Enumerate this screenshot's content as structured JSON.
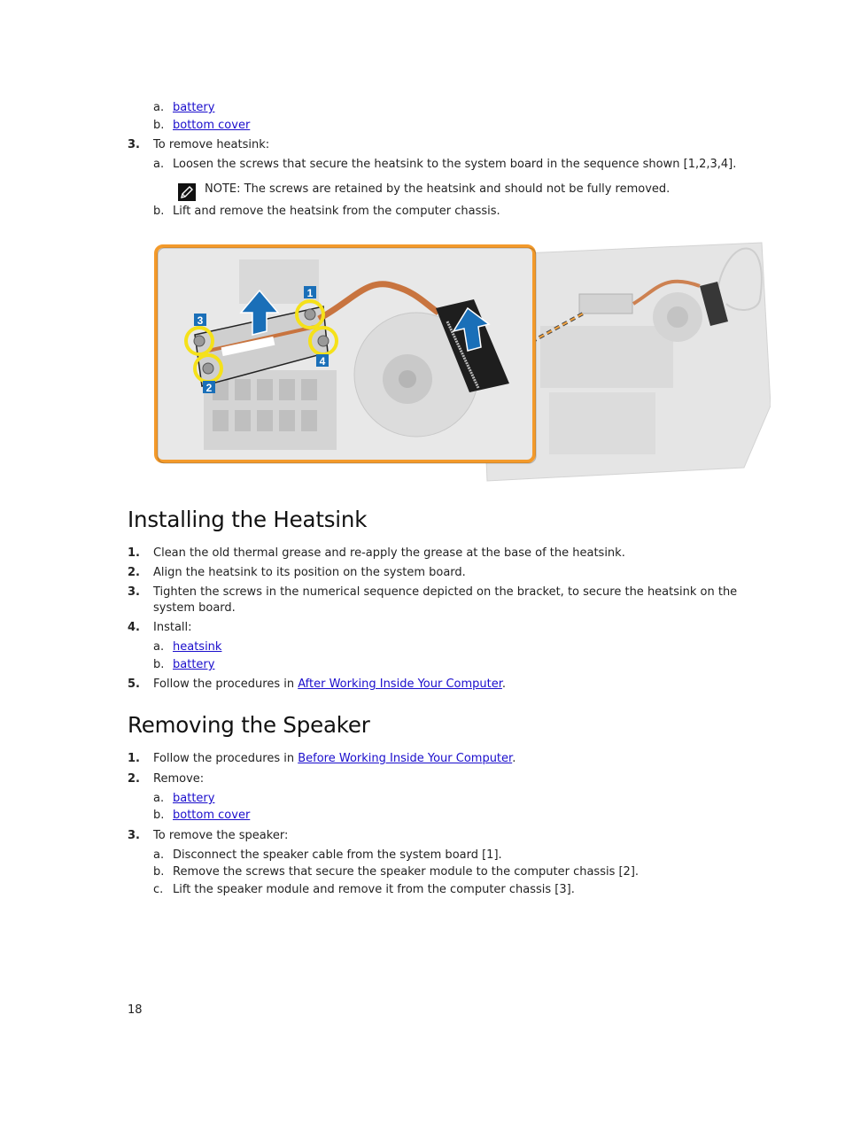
{
  "top_section": {
    "items": [
      {
        "marker": "a.",
        "link": "battery"
      },
      {
        "marker": "b.",
        "link": "bottom cover"
      }
    ],
    "step3": {
      "number": "3.",
      "text": "To remove heatsink:",
      "sub_a": {
        "marker": "a.",
        "text": "Loosen the screws that secure the heatsink to the system board in the sequence shown [1,2,3,4]."
      },
      "note": {
        "label": "NOTE:",
        "text": " The screws are retained by the heatsink and should not be fully removed."
      },
      "sub_b": {
        "marker": "b.",
        "text": "Lift and remove the heatsink from the computer chassis."
      }
    }
  },
  "figure": {
    "callouts": [
      "1",
      "2",
      "3",
      "4"
    ],
    "colors": {
      "frame": "#f39a2b",
      "callout_bg": "#1a6fb8",
      "ring": "#f5e11a",
      "arrow": "#1a6fb8",
      "copper": "#c8743f"
    }
  },
  "installing": {
    "title": "Installing the Heatsink",
    "steps": [
      {
        "number": "1.",
        "text": "Clean the old thermal grease and re-apply the grease at the base of the heatsink."
      },
      {
        "number": "2.",
        "text": "Align the heatsink to its position on the system board."
      },
      {
        "number": "3.",
        "text": "Tighten the screws in the numerical sequence depicted on the bracket, to secure the heatsink on the",
        "text2": "system board."
      },
      {
        "number": "4.",
        "text": "Install:"
      },
      {
        "number": "5.",
        "text": "Follow the procedures in ",
        "link": "After Working Inside Your Computer",
        "suffix": "."
      }
    ],
    "install_items": [
      {
        "marker": "a.",
        "link": "heatsink"
      },
      {
        "marker": "b.",
        "link": "battery"
      }
    ]
  },
  "removing": {
    "title": "Removing the Speaker",
    "steps": [
      {
        "number": "1.",
        "text": "Follow the procedures in ",
        "link": "Before Working Inside Your Computer",
        "suffix": "."
      },
      {
        "number": "2.",
        "text": "Remove:"
      },
      {
        "number": "3.",
        "text": "To remove the speaker:"
      }
    ],
    "remove_items": [
      {
        "marker": "a.",
        "link": "battery"
      },
      {
        "marker": "b.",
        "link": "bottom cover"
      }
    ],
    "speaker_substeps": [
      {
        "marker": "a.",
        "text": "Disconnect the speaker cable from the system board [1]."
      },
      {
        "marker": "b.",
        "text": "Remove the screws that secure the speaker module to the computer chassis [2]."
      },
      {
        "marker": "c.",
        "text": "Lift the speaker module and remove it from the computer chassis [3]."
      }
    ]
  },
  "footer": {
    "page_number": "18"
  }
}
